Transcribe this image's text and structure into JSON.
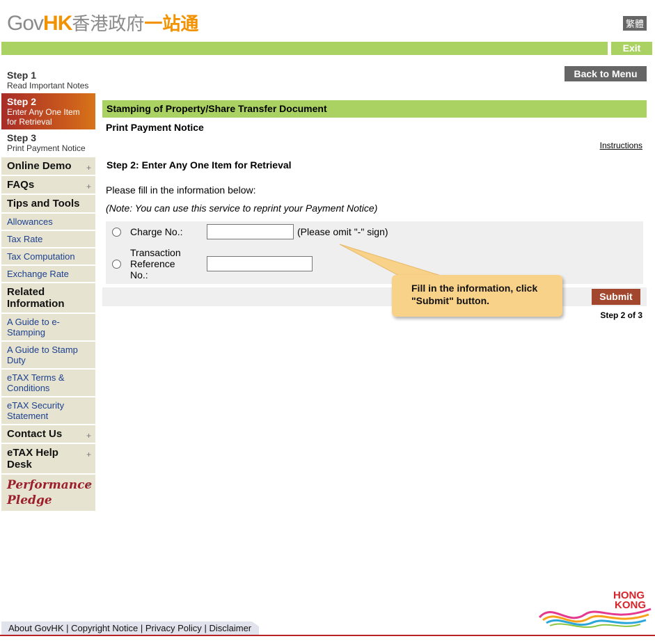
{
  "header": {
    "logo_gov": "Gov",
    "logo_hk": "HK",
    "logo_zh_grey": "香港政府",
    "logo_zh_orange": "一站通",
    "lang_button": "繁體",
    "exit_button": "Exit"
  },
  "sidebar": {
    "steps": [
      {
        "num": "Step 1",
        "text": "Read Important Notes"
      },
      {
        "num": "Step 2",
        "text": "Enter Any One Item for Retrieval"
      },
      {
        "num": "Step 3",
        "text": "Print Payment Notice"
      }
    ],
    "online_demo": "Online Demo",
    "faqs": "FAQs",
    "tips_tools": "Tips and Tools",
    "tips_links": [
      "Allowances",
      "Tax Rate",
      "Tax Computation",
      "Exchange Rate"
    ],
    "related_info": "Related Information",
    "related_links": [
      "A Guide to e-Stamping",
      "A Guide to Stamp Duty",
      "eTAX Terms & Conditions",
      "eTAX Security Statement"
    ],
    "contact_us": "Contact Us",
    "help_desk": "eTAX Help Desk",
    "pledge_line1": "Performance",
    "pledge_line2": "Pledge",
    "plus_symbol": "+"
  },
  "main": {
    "back_button": "Back to Menu",
    "title": "Stamping of Property/Share Transfer Document",
    "subtitle": "Print Payment Notice",
    "instructions": "Instructions",
    "step_heading": "Step 2: Enter Any One Item for Retrieval",
    "fill_text": "Please fill in the information below:",
    "note_text": "(Note: You can use this service to reprint your Payment Notice)",
    "form": {
      "charge_label": "Charge No.:",
      "charge_value": "",
      "charge_hint": "(Please omit \"-\" sign)",
      "txn_label_1": "Transaction",
      "txn_label_2": "Reference",
      "txn_label_3": "No.:",
      "txn_value": ""
    },
    "submit": "Submit",
    "step_count": "Step 2 of 3",
    "callout_1": "Fill in the information, click",
    "callout_2": "\"Submit\" button."
  },
  "footer": {
    "links": [
      "About GovHK",
      "Copyright Notice",
      "Privacy Policy",
      "Disclaimer"
    ],
    "separator": "|",
    "brand_1": "HONG",
    "brand_2": "KONG"
  },
  "colors": {
    "green": "#a9d262",
    "orange": "#f39200",
    "active_step": "#a82c28",
    "submit": "#a2462e",
    "nav_bg": "#e6e4d1",
    "callout": "#f9d28a"
  }
}
